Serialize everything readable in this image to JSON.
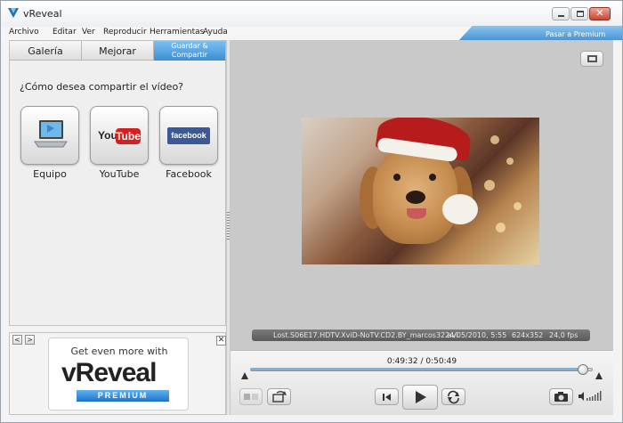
{
  "window": {
    "title": "vReveal",
    "minimize_glyph": "—",
    "maximize_glyph": "□",
    "close_glyph": "✕"
  },
  "menu": {
    "items": [
      "Archivo",
      "Editar",
      "Ver",
      "Reproducir",
      "Herramientas",
      "Ayuda"
    ],
    "premium_link": "Pasar a Premium"
  },
  "tabs": {
    "galeria": "Galería",
    "mejorar": "Mejorar",
    "guardar_line1": "Guardar &",
    "guardar_line2": "Compartir"
  },
  "share": {
    "question": "¿Cómo desea compartir el vídeo?",
    "options": [
      {
        "label": "Equipo",
        "icon": "laptop-icon"
      },
      {
        "label": "YouTube",
        "icon": "youtube-logo"
      },
      {
        "label": "Facebook",
        "icon": "facebook-logo"
      }
    ],
    "youtube_you": "You",
    "youtube_tube": "Tube",
    "facebook_logo": "facebook"
  },
  "promo": {
    "nav_prev": "<",
    "nav_next": ">",
    "close": "✕",
    "headline": "Get even more with",
    "brand": "vReveal",
    "tier": "PREMIUM"
  },
  "player": {
    "file_name": "Lost.S06E17.HDTV.XviD-NoTV.CD2.BY_marcos32.avi",
    "date": "24/05/2010, 5:55",
    "resolution": "624x352",
    "fps": "24,0 fps",
    "time_readout": "0:49:32 / 0:50:49",
    "progress_fraction": 0.975
  },
  "colors": {
    "accent": "#3d8fd6",
    "video_bg": "#c9c9c9"
  }
}
